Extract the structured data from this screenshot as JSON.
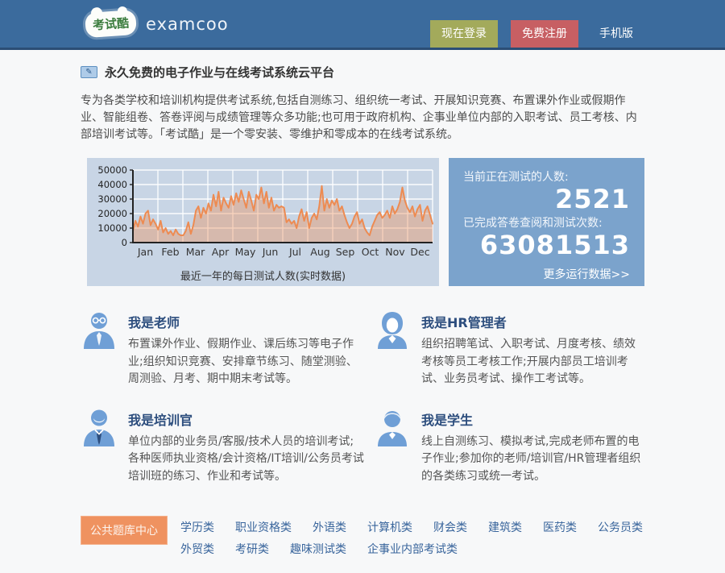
{
  "header": {
    "logo_cn": "考试酷",
    "logo_en": "examcoo",
    "login_label": "现在登录",
    "register_label": "免费注册",
    "mobile_label": "手机版"
  },
  "intro": {
    "title": "永久免费的电子作业与在线考试系统云平台",
    "description": "专为各类学校和培训机构提供考试系统,包括自测练习、组织统一考试、开展知识竞赛、布置课外作业或假期作业、智能组卷、答卷评阅与成绩管理等众多功能;也可用于政府机构、企事业单位内部的入职考试、员工考核、内部培训考试等。「考试酷」是一个零安装、零维护和零成本的在线考试系统。"
  },
  "chart_data": {
    "type": "area",
    "title": "最近一年的每日测试人数(实时数据)",
    "categories": [
      "Jan",
      "Feb",
      "Mar",
      "Apr",
      "May",
      "Jun",
      "Jul",
      "Aug",
      "Sep",
      "Oct",
      "Nov",
      "Dec"
    ],
    "values": [
      8000,
      15000,
      11000,
      18000,
      13000,
      20000,
      22000,
      12000,
      16000,
      13000,
      9000,
      15000,
      7000,
      10000,
      6000,
      8000,
      5000,
      9000,
      6000,
      5000,
      5000,
      8000,
      14000,
      6000,
      12000,
      22000,
      25000,
      17000,
      24000,
      20000,
      27000,
      22000,
      33000,
      25000,
      35000,
      22000,
      31000,
      27000,
      24000,
      32000,
      26000,
      34000,
      28000,
      36000,
      30000,
      24000,
      35000,
      29000,
      22000,
      33000,
      30000,
      38000,
      27000,
      35000,
      24000,
      31000,
      22000,
      26000,
      24000,
      25000,
      24000,
      14000,
      16000,
      13000,
      15000,
      10000,
      18000,
      23000,
      15000,
      21000,
      10000,
      17000,
      20000,
      16000,
      25000,
      39000,
      22000,
      30000,
      24000,
      29000,
      26000,
      30000,
      22000,
      25000,
      19000,
      14000,
      10000,
      13000,
      18000,
      21000,
      13000,
      16000,
      10000,
      7000,
      5000,
      11000,
      15000,
      19000,
      21000,
      17000,
      19000,
      22000,
      17000,
      25000,
      20000,
      23000,
      28000,
      38000,
      29000,
      24000,
      21000,
      25000,
      18000,
      23000,
      26000,
      15000,
      22000,
      25000,
      19000,
      13000
    ],
    "ylim": [
      0,
      50000
    ],
    "yticks": [
      0,
      10000,
      20000,
      30000,
      40000,
      50000
    ],
    "grid": true,
    "legend": false,
    "line_color": "#ed8b52",
    "fill_color": "rgba(237,139,82,0.38)",
    "panel_bg": "#c8d5e5"
  },
  "stats": {
    "current_label": "当前正在测试的人数:",
    "current_value": "2521",
    "completed_label": "已完成答卷查阅和测试次数:",
    "completed_value": "63081513",
    "more_label": "更多运行数据>>"
  },
  "roles": [
    {
      "id": "teacher",
      "title": "我是老师",
      "description": "布置课外作业、假期作业、课后练习等电子作业;组织知识竞赛、安排章节练习、随堂测验、周测验、月考、期中期末考试等。"
    },
    {
      "id": "hr",
      "title": "我是HR管理者",
      "description": "组织招聘笔试、入职考试、月度考核、绩效考核等员工考核工作;开展内部员工培训考试、业务员考试、操作工考试等。"
    },
    {
      "id": "trainer",
      "title": "我是培训官",
      "description": "单位内部的业务员/客服/技术人员的培训考试;各种医师执业资格/会计资格/IT培训/公务员考试培训班的练习、作业和考试等。"
    },
    {
      "id": "student",
      "title": "我是学生",
      "description": "线上自测练习、模拟考试,完成老师布置的电子作业;参加你的老师/培训官/HR管理者组织的各类练习或统一考试。"
    }
  ],
  "qbank": {
    "button_label": "公共题库中心",
    "links": [
      "学历类",
      "职业资格类",
      "外语类",
      "计算机类",
      "财会类",
      "建筑类",
      "医药类",
      "公务员类",
      "外贸类",
      "考研类",
      "趣味测试类",
      "企事业内部考试类"
    ]
  },
  "colors": {
    "header_bg": "#3b6b9d",
    "login_btn": "#a3aa5b",
    "register_btn": "#c75f63",
    "stats_panel_bg": "#7ba3cc",
    "qbank_btn": "#ef9260",
    "link_color": "#39659c",
    "role_title": "#2d4e7e"
  }
}
